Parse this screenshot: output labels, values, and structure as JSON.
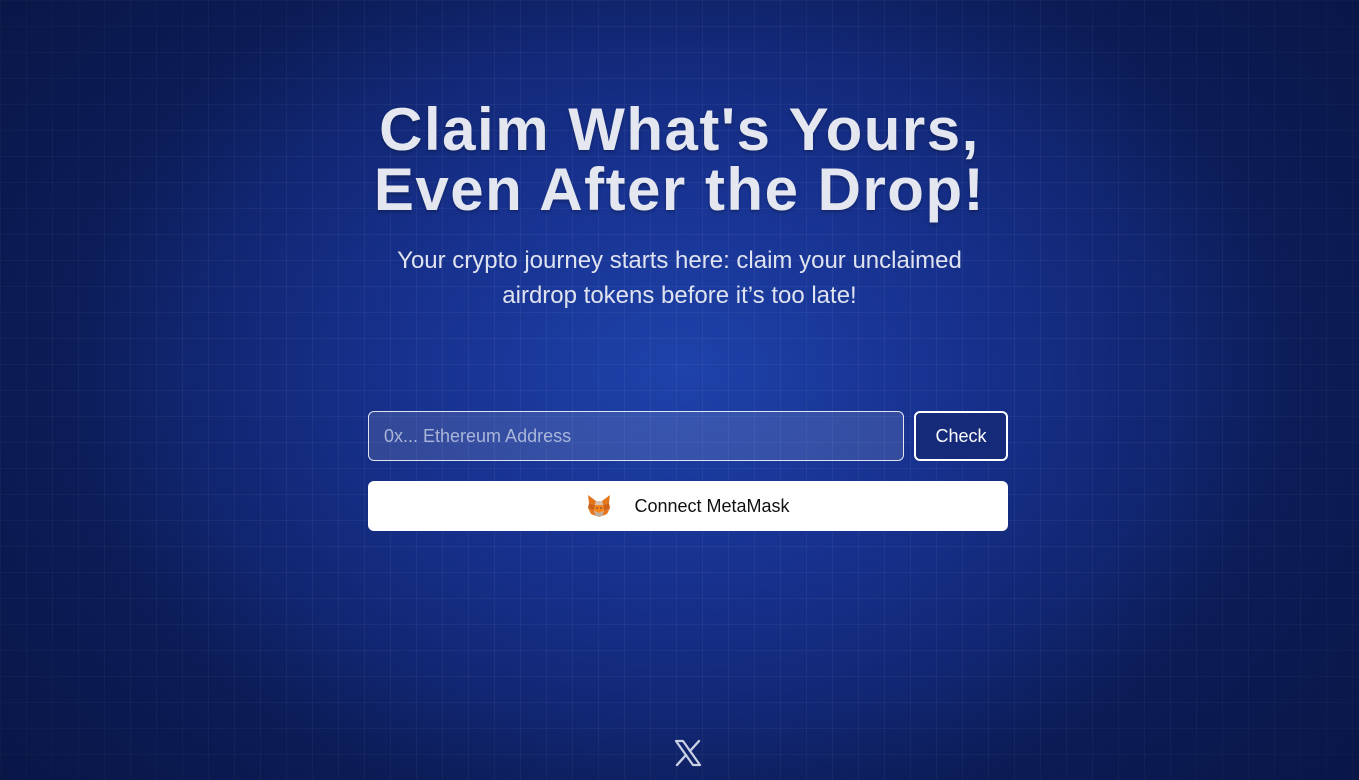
{
  "hero": {
    "headline": "Claim What's Yours, Even After the Drop!",
    "subtitle": "Your crypto journey starts here: claim your unclaimed airdrop tokens before it’s too late!"
  },
  "address_form": {
    "placeholder": "0x... Ethereum Address",
    "value": "",
    "check_label": "Check"
  },
  "wallet": {
    "connect_label": "Connect MetaMask",
    "icon": "metamask-fox-icon"
  },
  "footer": {
    "social_icon": "x-logo-icon"
  },
  "colors": {
    "background": "#0d1f5e",
    "glow": "#1e42aa",
    "check_button_bg": "#152a78",
    "text_light": "#e4e7f0"
  }
}
